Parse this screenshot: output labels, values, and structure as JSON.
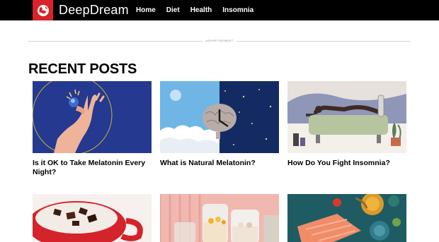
{
  "site": {
    "brand": "DeepDream",
    "nav": [
      "Home",
      "Diet",
      "Health",
      "Insomnia"
    ]
  },
  "ad_label": "ADVERTISEMENT",
  "section_title": "RECENT POSTS",
  "posts": [
    {
      "title": "Is it OK to Take Melatonin Every Night?"
    },
    {
      "title": "What is Natural Melatonin?"
    },
    {
      "title": "How Do You Fight Insomnia?"
    }
  ],
  "colors": {
    "header_bg": "#000000",
    "logo_red": "#d8232a"
  }
}
